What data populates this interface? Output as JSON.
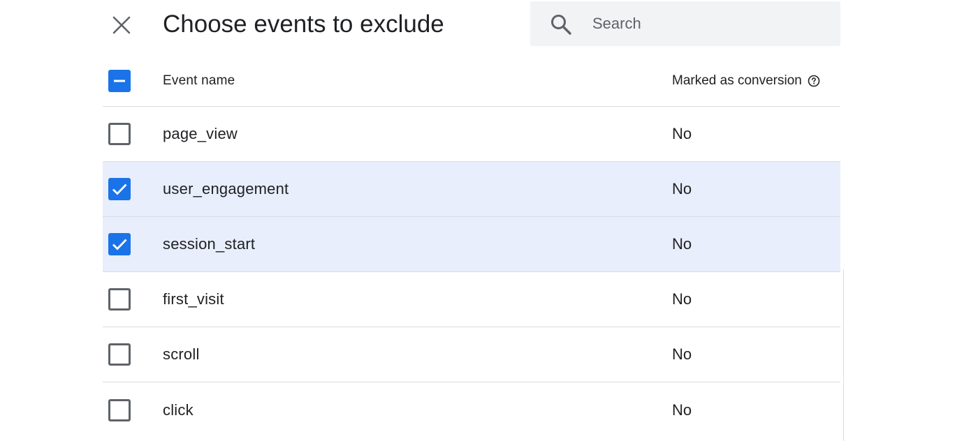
{
  "dialog": {
    "title": "Choose events to exclude",
    "close_icon": "close-icon"
  },
  "search": {
    "placeholder": "Search",
    "value": "",
    "icon": "search-icon"
  },
  "table": {
    "columns": {
      "event_name": "Event name",
      "marked_as_conversion": "Marked as conversion"
    },
    "header_checkbox_state": "indeterminate",
    "help_icon": "help-circle-icon",
    "rows": [
      {
        "event_name": "page_view",
        "marked_as_conversion": "No",
        "checked": false
      },
      {
        "event_name": "user_engagement",
        "marked_as_conversion": "No",
        "checked": true
      },
      {
        "event_name": "session_start",
        "marked_as_conversion": "No",
        "checked": true
      },
      {
        "event_name": "first_visit",
        "marked_as_conversion": "No",
        "checked": false
      },
      {
        "event_name": "scroll",
        "marked_as_conversion": "No",
        "checked": false
      },
      {
        "event_name": "click",
        "marked_as_conversion": "No",
        "checked": false
      }
    ]
  },
  "colors": {
    "accent": "#1a73e8",
    "selected_row": "#e8eefc",
    "search_bg": "#f1f3f4"
  }
}
